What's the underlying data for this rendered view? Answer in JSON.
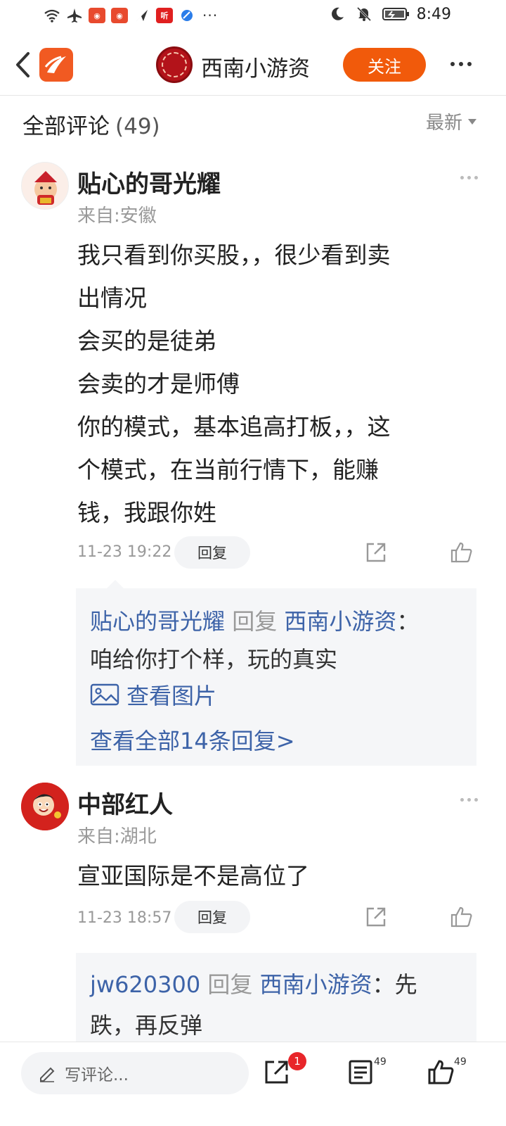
{
  "status_bar": {
    "time": "8:49",
    "left_icons": [
      "wifi-icon",
      "airplane-icon",
      "weibo-icon",
      "weibo-icon",
      "send-icon",
      "ting-icon",
      "browser-icon"
    ],
    "right_icons": [
      "moon-icon",
      "mute-icon",
      "battery-icon"
    ],
    "ting_label": "听"
  },
  "header": {
    "author_name": "西南小游资",
    "follow_label": "关注"
  },
  "comments_section": {
    "title": "全部评论",
    "count": "(49)",
    "sort_label": "最新"
  },
  "comments": [
    {
      "name": "贴心的哥光耀",
      "from": "来自:安徽",
      "lines": [
        "我只看到你买股，，很少看到卖",
        "出情况",
        "会买的是徒弟",
        "会卖的才是师傅",
        "你的模式，基本追高打板，，这",
        "个模式，在当前行情下，能赚",
        "钱，我跟你姓"
      ],
      "time": "11-23 19:22",
      "reply_label": "回复",
      "reply_box": {
        "replier": "贴心的哥光耀",
        "reply_word": "回复",
        "target": "西南小游资",
        "colon": "：",
        "text": "咱给你打个样，玩的真实",
        "view_image": "查看图片",
        "view_all": "查看全部14条回复>"
      }
    },
    {
      "name": "中部红人",
      "from": "来自:湖北",
      "lines": [
        "宣亚国际是不是高位了"
      ],
      "time": "11-23 18:57",
      "reply_label": "回复",
      "reply_box": {
        "replier": "jw620300",
        "reply_word": "回复",
        "target": "西南小游资",
        "colon": "：",
        "text_first": "先",
        "text": "跌，再反弹"
      }
    }
  ],
  "bottom_bar": {
    "input_placeholder": "写评论...",
    "share_badge": "1",
    "comment_count": "49",
    "like_count": "49"
  },
  "colors": {
    "accent": "#f15a0b",
    "link_blue": "#3d63a8",
    "badge_red": "#e8262a"
  }
}
